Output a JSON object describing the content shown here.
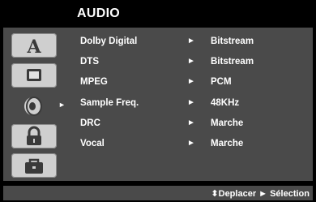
{
  "title": "AUDIO",
  "tabs": [
    {
      "name": "language-tab",
      "icon": "letter-a-icon"
    },
    {
      "name": "display-tab",
      "icon": "tv-screen-icon"
    },
    {
      "name": "audio-tab",
      "icon": "speaker-icon",
      "active": true
    },
    {
      "name": "lock-tab",
      "icon": "lock-icon"
    },
    {
      "name": "others-tab",
      "icon": "briefcase-icon"
    }
  ],
  "rows": [
    {
      "label": "Dolby Digital",
      "arrow": "►",
      "value": "Bitstream"
    },
    {
      "label": "DTS",
      "arrow": "►",
      "value": "Bitstream"
    },
    {
      "label": "MPEG",
      "arrow": "►",
      "value": "PCM"
    },
    {
      "label": "Sample Freq.",
      "arrow": "►",
      "value": "48KHz"
    },
    {
      "label": "DRC",
      "arrow": "►",
      "value": "Marche"
    },
    {
      "label": "Vocal",
      "arrow": "►",
      "value": "Marche"
    }
  ],
  "active_tab_pointer": "►",
  "footer": {
    "hint": "⬍Deplacer ► Sélection"
  },
  "colors": {
    "background": "#000000",
    "panel": "#4a4a4a",
    "tab": "#cfcfcf",
    "text": "#ffffff"
  }
}
